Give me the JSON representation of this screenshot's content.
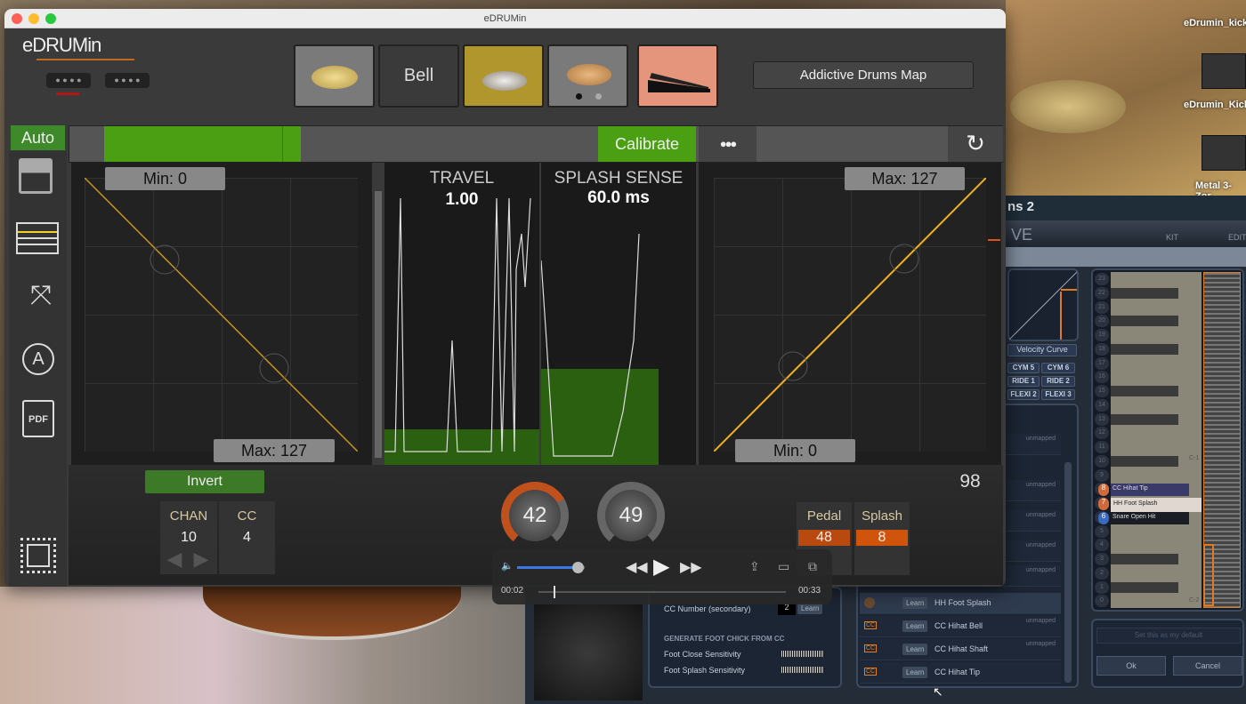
{
  "window": {
    "title": "eDRUMin",
    "logo": "eDRUMin"
  },
  "pads": [
    {
      "name": "cymbal-bow"
    },
    {
      "label": "Bell"
    },
    {
      "name": "hihat"
    },
    {
      "name": "crash-cymbal"
    },
    {
      "name": "hihat-pedal"
    }
  ],
  "map_button": "Addictive Drums Map",
  "toolbar": {
    "auto": "Auto",
    "calibrate": "Calibrate",
    "level_percent": 21
  },
  "left_curve": {
    "min": "Min: 0",
    "max": "Max: 127"
  },
  "right_curve": {
    "min": "Min: 0",
    "max": "Max: 127"
  },
  "travel": {
    "label": "TRAVEL",
    "value": "1.00"
  },
  "splash": {
    "label": "SPLASH SENSE",
    "value": "60.0 ms"
  },
  "bottom": {
    "invert": "Invert",
    "chan_label": "CHAN",
    "chan_value": "10",
    "cc_label": "CC",
    "cc_value": "4",
    "knob1": "42",
    "knob2": "49",
    "readout": "98",
    "pedal_label": "Pedal",
    "pedal_value": "48",
    "splash_label": "Splash",
    "splash_value": "8"
  },
  "player": {
    "elapsed": "00:02",
    "duration": "00:33",
    "volume_percent": 90,
    "progress_percent": 6
  },
  "background": {
    "video_labels": [
      "eDrumin_kick-",
      "eDrumin_Kick-",
      "Metal 3-Zor"
    ],
    "ad_title": "ns 2",
    "ad_logo": "VE",
    "tabs": [
      "KIT",
      "EDIT"
    ],
    "velocity_curve": "Velocity Curve",
    "tags": [
      "CYM 5",
      "CYM 6",
      "RIDE 1",
      "RIDE 2",
      "FLEXI 2",
      "FLEXI 3"
    ],
    "unmapped": "unmapped",
    "learn": "Learn",
    "cc": "CC",
    "map_rows": [
      "HH Foot Splash",
      "CC Hihat Bell",
      "CC Hihat Shaft",
      "CC Hihat Tip"
    ],
    "cc_secondary": "CC Number (secondary)",
    "cc_secondary_value": "2",
    "generate_header": "GENERATE FOOT CHICK FROM CC",
    "foot_close": "Foot Close Sensitivity",
    "foot_splash": "Foot Splash Sensitivity",
    "keys": [
      "23",
      "22",
      "21",
      "20",
      "19",
      "18",
      "17",
      "16",
      "15",
      "14",
      "13",
      "12",
      "11",
      "10",
      "9",
      "8",
      "7",
      "6",
      "5",
      "4",
      "3",
      "2",
      "1",
      "0"
    ],
    "key_labels": [
      {
        "num": "8",
        "text": "CC Hihat Tip"
      },
      {
        "num": "7",
        "text": "HH Foot Splash"
      },
      {
        "num": "6",
        "text": "Snare Open Hit"
      }
    ],
    "octaves": [
      "C-1",
      "C-2"
    ],
    "set_default": "Set this as my default",
    "ok": "Ok",
    "cancel": "Cancel"
  }
}
